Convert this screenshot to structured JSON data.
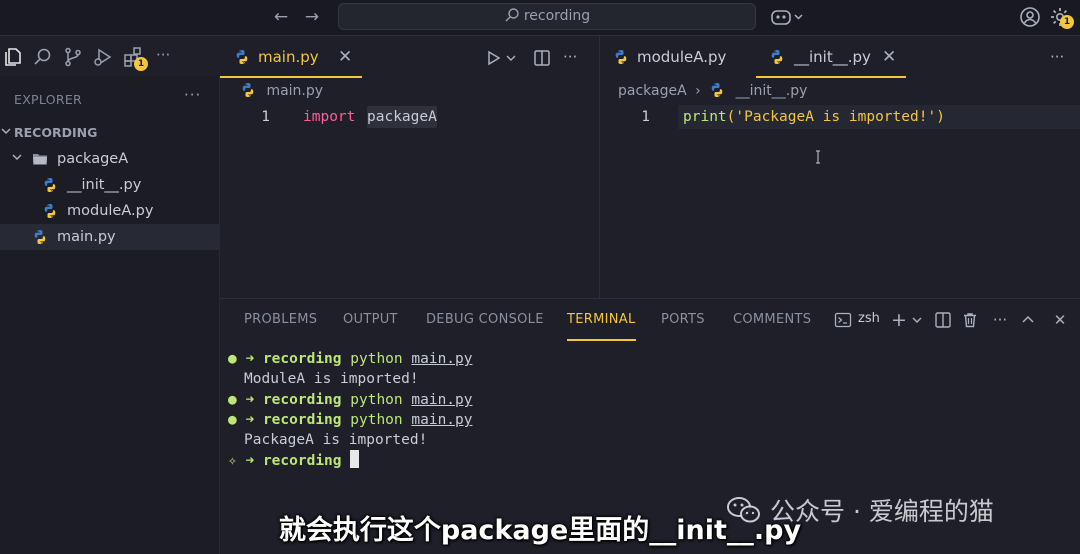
{
  "titlebar": {
    "search_text": "recording"
  },
  "activity": {
    "badge_count": "1",
    "settings_badge": "1"
  },
  "sidebar": {
    "title": "EXPLORER",
    "workspace": "RECORDING",
    "items": [
      {
        "label": "packageA"
      },
      {
        "label": "__init__.py"
      },
      {
        "label": "moduleA.py"
      },
      {
        "label": "main.py"
      }
    ]
  },
  "editor_left": {
    "tab_label": "main.py",
    "breadcrumb": "main.py",
    "line_number": "1",
    "code_keyword": "import",
    "code_name": "packageA"
  },
  "editor_right": {
    "tabs": [
      {
        "label": "moduleA.py"
      },
      {
        "label": "__init__.py"
      }
    ],
    "breadcrumb_folder": "packageA",
    "breadcrumb_file": "__init__.py",
    "line_number": "1",
    "code_fn": "print",
    "code_open": "(",
    "code_str": "'PackageA is imported!'",
    "code_close": ")"
  },
  "panel": {
    "tabs": [
      "PROBLEMS",
      "OUTPUT",
      "DEBUG CONSOLE",
      "TERMINAL",
      "PORTS",
      "COMMENTS"
    ],
    "shell": "zsh",
    "terminal": {
      "prompt_dir": "recording",
      "cmd": "python",
      "arg": "main.py",
      "output1": "ModuleA is imported!",
      "output2": "PackageA is imported!"
    }
  },
  "overlay": {
    "watermark": "公众号 · 爱编程的猫",
    "subtitle": "就会执行这个package里面的__init__.py"
  },
  "colors": {
    "accent": "#f3c640",
    "keyword": "#ff5e94",
    "function": "#bde676"
  }
}
